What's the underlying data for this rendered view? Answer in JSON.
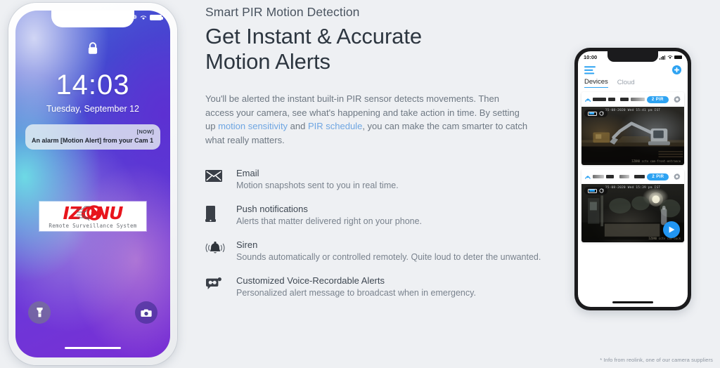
{
  "background_color": "#eef0f3",
  "accent_blue": "#2ea3f2",
  "link_color": "#6fa6e2",
  "left_phone": {
    "status_bar": {
      "bluetooth_icon": "bluetooth-icon",
      "wifi_icon": "wifi-icon",
      "battery_icon": "battery-icon"
    },
    "lock_icon": "lock-icon",
    "time": "14:03",
    "date": "Tuesday, September 12",
    "notification": {
      "timestamp": "[NOW]",
      "message": "An alarm [Motion Alert] from your Cam 1"
    },
    "logo": {
      "name": "IZONU",
      "tagline": "Remote Surveillance System"
    },
    "flashlight_icon": "flashlight-icon",
    "camera_icon": "camera-icon"
  },
  "content": {
    "eyebrow": "Smart PIR Motion Detection",
    "headline_line_1": "Get Instant & Accurate",
    "headline_line_2": "Motion Alerts",
    "paragraph": {
      "part_1": "You'll be alerted the instant built-in PIR sensor detects movements. Then access your camera, see what's happening and take action in time. By setting up ",
      "link_1": "motion sensitivity",
      "part_2": " and ",
      "link_2": "PIR schedule",
      "part_3": ", you can make the cam smarter to catch what really matters."
    },
    "features": [
      {
        "icon": "envelope-icon",
        "title": "Email",
        "description": "Motion snapshots sent to you in real time."
      },
      {
        "icon": "mobile-phone-icon",
        "title": "Push notifications",
        "description": "Alerts that matter delivered right on your phone."
      },
      {
        "icon": "siren-bell-icon",
        "title": "Siren",
        "description": "Sounds automatically or controlled remotely. Quite loud to deter the unwanted."
      },
      {
        "icon": "voice-megaphone-icon",
        "title": "Customized Voice-Recordable Alerts",
        "description": "Personalized alert message to broadcast when in emergency."
      }
    ]
  },
  "right_phone": {
    "status_bar": {
      "clock": "10:00",
      "signal_icon": "cellular-signal-icon",
      "wifi_icon": "wifi-icon",
      "battery_icon": "battery-icon"
    },
    "menu_icon": "hamburger-menu-icon",
    "add_icon": "add-plus-icon",
    "tabs": [
      {
        "label": "Devices",
        "active": true
      },
      {
        "label": "Cloud",
        "active": false
      }
    ],
    "devices": [
      {
        "status_icon": "camera-status-icon",
        "name_redacted": true,
        "badge": "2 PIR",
        "settings_icon": "gear-icon",
        "feed": {
          "timestamp": "25-08-2020 Wed 15:41 pm IST",
          "watermark": "IZONU  cctv  cam-front-entrance",
          "battery_icon": "battery-icon",
          "refresh_icon": "refresh-icon",
          "scene": "construction-site-excavator-night"
        }
      },
      {
        "status_icon": "camera-status-icon",
        "name_redacted": true,
        "badge": "2 PIR",
        "settings_icon": "gear-icon",
        "feed": {
          "timestamp": "25-08-2020 Wed 15:39 pm IST",
          "watermark": "IZONU  cctv  cam-back",
          "battery_icon": "battery-icon",
          "refresh_icon": "refresh-icon",
          "scene": "yard-night-view",
          "play_button": "play-icon"
        }
      }
    ]
  },
  "footnote": "* Info from reolink, one of our camera suppliers"
}
